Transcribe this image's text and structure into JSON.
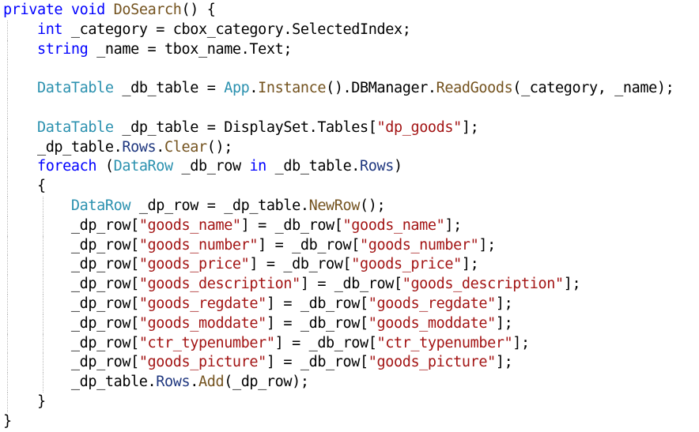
{
  "editor": {
    "colors": {
      "keyword": "#0000ff",
      "type": "#2b91af",
      "method": "#74531f",
      "string": "#a31515",
      "member": "#1f377f",
      "plain": "#000000",
      "background": "#ffffff",
      "indent_guide": "#b7b7b7"
    },
    "lines": [
      {
        "indent": 0,
        "tokens": [
          {
            "c": "kw",
            "t": "private"
          },
          {
            "c": "plain",
            "t": " "
          },
          {
            "c": "kw",
            "t": "void"
          },
          {
            "c": "plain",
            "t": " "
          },
          {
            "c": "method",
            "t": "DoSearch"
          },
          {
            "c": "plain",
            "t": "() {"
          }
        ]
      },
      {
        "indent": 1,
        "tokens": [
          {
            "c": "kw",
            "t": "int"
          },
          {
            "c": "plain",
            "t": " _category = cbox_category.SelectedIndex;"
          }
        ]
      },
      {
        "indent": 1,
        "tokens": [
          {
            "c": "kw",
            "t": "string"
          },
          {
            "c": "plain",
            "t": " _name = tbox_name.Text;"
          }
        ]
      },
      {
        "indent": 1,
        "tokens": []
      },
      {
        "indent": 1,
        "tokens": [
          {
            "c": "type",
            "t": "DataTable"
          },
          {
            "c": "plain",
            "t": " _db_table = "
          },
          {
            "c": "type",
            "t": "App"
          },
          {
            "c": "plain",
            "t": "."
          },
          {
            "c": "method",
            "t": "Instance"
          },
          {
            "c": "plain",
            "t": "().DBManager."
          },
          {
            "c": "method",
            "t": "ReadGoods"
          },
          {
            "c": "plain",
            "t": "(_category, _name);"
          }
        ]
      },
      {
        "indent": 1,
        "tokens": []
      },
      {
        "indent": 1,
        "tokens": [
          {
            "c": "type",
            "t": "DataTable"
          },
          {
            "c": "plain",
            "t": " _dp_table = DisplaySet.Tables["
          },
          {
            "c": "str",
            "t": "\"dp_goods\""
          },
          {
            "c": "plain",
            "t": "];"
          }
        ]
      },
      {
        "indent": 1,
        "tokens": [
          {
            "c": "plain",
            "t": "_dp_table."
          },
          {
            "c": "member",
            "t": "Rows"
          },
          {
            "c": "plain",
            "t": "."
          },
          {
            "c": "method",
            "t": "Clear"
          },
          {
            "c": "plain",
            "t": "();"
          }
        ]
      },
      {
        "indent": 1,
        "tokens": [
          {
            "c": "kw",
            "t": "foreach"
          },
          {
            "c": "plain",
            "t": " ("
          },
          {
            "c": "type",
            "t": "DataRow"
          },
          {
            "c": "plain",
            "t": " _db_row "
          },
          {
            "c": "kw",
            "t": "in"
          },
          {
            "c": "plain",
            "t": " _db_table."
          },
          {
            "c": "member",
            "t": "Rows"
          },
          {
            "c": "plain",
            "t": ")"
          }
        ]
      },
      {
        "indent": 1,
        "tokens": [
          {
            "c": "plain",
            "t": "{"
          }
        ]
      },
      {
        "indent": 2,
        "tokens": [
          {
            "c": "type",
            "t": "DataRow"
          },
          {
            "c": "plain",
            "t": " _dp_row = _dp_table."
          },
          {
            "c": "method",
            "t": "NewRow"
          },
          {
            "c": "plain",
            "t": "();"
          }
        ]
      },
      {
        "indent": 2,
        "tokens": [
          {
            "c": "plain",
            "t": "_dp_row["
          },
          {
            "c": "str",
            "t": "\"goods_name\""
          },
          {
            "c": "plain",
            "t": "] = _db_row["
          },
          {
            "c": "str",
            "t": "\"goods_name\""
          },
          {
            "c": "plain",
            "t": "];"
          }
        ]
      },
      {
        "indent": 2,
        "tokens": [
          {
            "c": "plain",
            "t": "_dp_row["
          },
          {
            "c": "str",
            "t": "\"goods_number\""
          },
          {
            "c": "plain",
            "t": "] = _db_row["
          },
          {
            "c": "str",
            "t": "\"goods_number\""
          },
          {
            "c": "plain",
            "t": "];"
          }
        ]
      },
      {
        "indent": 2,
        "tokens": [
          {
            "c": "plain",
            "t": "_dp_row["
          },
          {
            "c": "str",
            "t": "\"goods_price\""
          },
          {
            "c": "plain",
            "t": "] = _db_row["
          },
          {
            "c": "str",
            "t": "\"goods_price\""
          },
          {
            "c": "plain",
            "t": "];"
          }
        ]
      },
      {
        "indent": 2,
        "tokens": [
          {
            "c": "plain",
            "t": "_dp_row["
          },
          {
            "c": "str",
            "t": "\"goods_description\""
          },
          {
            "c": "plain",
            "t": "] = _db_row["
          },
          {
            "c": "str",
            "t": "\"goods_description\""
          },
          {
            "c": "plain",
            "t": "];"
          }
        ]
      },
      {
        "indent": 2,
        "tokens": [
          {
            "c": "plain",
            "t": "_dp_row["
          },
          {
            "c": "str",
            "t": "\"goods_regdate\""
          },
          {
            "c": "plain",
            "t": "] = _db_row["
          },
          {
            "c": "str",
            "t": "\"goods_regdate\""
          },
          {
            "c": "plain",
            "t": "];"
          }
        ]
      },
      {
        "indent": 2,
        "tokens": [
          {
            "c": "plain",
            "t": "_dp_row["
          },
          {
            "c": "str",
            "t": "\"goods_moddate\""
          },
          {
            "c": "plain",
            "t": "] = _db_row["
          },
          {
            "c": "str",
            "t": "\"goods_moddate\""
          },
          {
            "c": "plain",
            "t": "];"
          }
        ]
      },
      {
        "indent": 2,
        "tokens": [
          {
            "c": "plain",
            "t": "_dp_row["
          },
          {
            "c": "str",
            "t": "\"ctr_typenumber\""
          },
          {
            "c": "plain",
            "t": "] = _db_row["
          },
          {
            "c": "str",
            "t": "\"ctr_typenumber\""
          },
          {
            "c": "plain",
            "t": "];"
          }
        ]
      },
      {
        "indent": 2,
        "tokens": [
          {
            "c": "plain",
            "t": "_dp_row["
          },
          {
            "c": "str",
            "t": "\"goods_picture\""
          },
          {
            "c": "plain",
            "t": "] = _db_row["
          },
          {
            "c": "str",
            "t": "\"goods_picture\""
          },
          {
            "c": "plain",
            "t": "];"
          }
        ]
      },
      {
        "indent": 2,
        "tokens": [
          {
            "c": "plain",
            "t": "_dp_table."
          },
          {
            "c": "member",
            "t": "Rows"
          },
          {
            "c": "plain",
            "t": "."
          },
          {
            "c": "method",
            "t": "Add"
          },
          {
            "c": "plain",
            "t": "(_dp_row);"
          }
        ]
      },
      {
        "indent": 1,
        "tokens": [
          {
            "c": "plain",
            "t": "}"
          }
        ]
      },
      {
        "indent": 0,
        "tokens": [
          {
            "c": "plain",
            "t": "}"
          }
        ]
      }
    ]
  }
}
